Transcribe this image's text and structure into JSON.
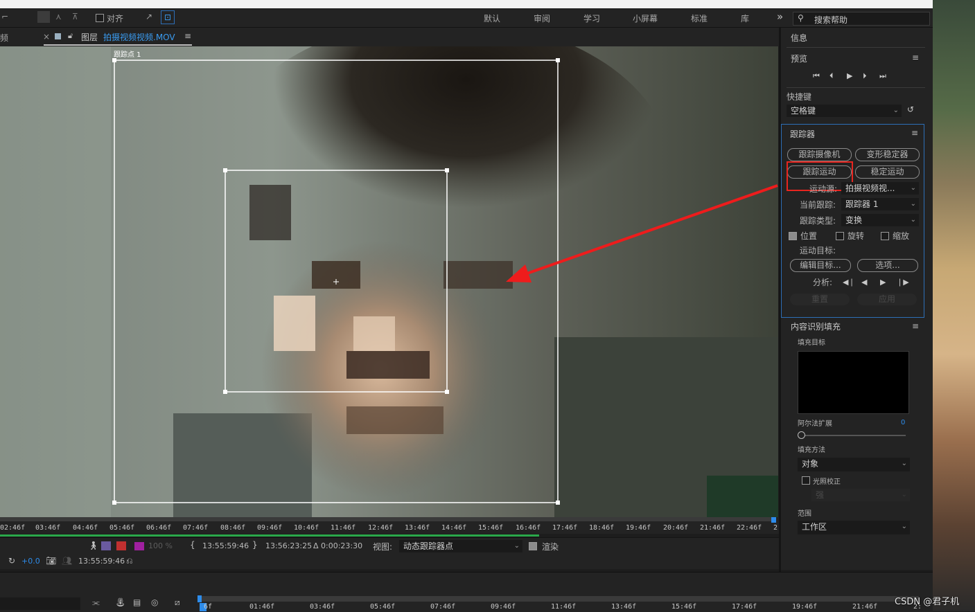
{
  "topbar": {
    "align_label": "对齐",
    "workspaces": [
      "默认",
      "审阅",
      "学习",
      "小屏幕",
      "标准",
      "库"
    ],
    "more": "»",
    "search_placeholder": "搜索帮助"
  },
  "layer_tab": {
    "prefix": "图层",
    "name": "拍摄视频视频.MOV",
    "left_fragment": "频",
    "close": "×",
    "menu": "≡"
  },
  "viewer": {
    "track_point_label": "跟踪点 1"
  },
  "ruler": {
    "ticks": [
      "02:46f",
      "03:46f",
      "04:46f",
      "05:46f",
      "06:46f",
      "07:46f",
      "08:46f",
      "09:46f",
      "10:46f",
      "11:46f",
      "12:46f",
      "13:46f",
      "14:46f",
      "15:46f",
      "16:46f",
      "17:46f",
      "18:46f",
      "19:46f",
      "20:46f",
      "21:46f",
      "22:46f",
      "2"
    ]
  },
  "controls": {
    "zoom": "100 %",
    "in_time": "13:55:59:46",
    "out_time": "13:56:23:25",
    "duration": "Δ 0:00:23:30",
    "view_label": "视图:",
    "view_value": "动态跟踪器点",
    "render_label": "渲染",
    "exposure": "+0.0",
    "current_time": "13:55:59:46"
  },
  "timeline": {
    "ticks": [
      "6f",
      "01:46f",
      "03:46f",
      "05:46f",
      "07:46f",
      "09:46f",
      "11:46f",
      "13:46f",
      "15:46f",
      "17:46f",
      "19:46f",
      "21:46f",
      "2:"
    ]
  },
  "right_panel": {
    "info_title": "信息",
    "preview_title": "预览",
    "shortcut_label": "快捷键",
    "shortcut_value": "空格键",
    "tracker_title": "跟踪器",
    "track_camera": "跟踪摄像机",
    "warp_stabilizer": "变形稳定器",
    "track_motion": "跟踪运动",
    "stabilize_motion": "稳定运动",
    "motion_source_label": "运动源:",
    "motion_source_value": "拍摄视频视...",
    "current_track_label": "当前跟踪:",
    "current_track_value": "跟踪器 1",
    "track_type_label": "跟踪类型:",
    "track_type_value": "变换",
    "position": "位置",
    "rotation": "旋转",
    "scale": "缩放",
    "motion_target_label": "运动目标:",
    "edit_target": "编辑目标...",
    "options": "选项...",
    "analyze_label": "分析:",
    "reset": "重置",
    "apply": "应用",
    "caf_title": "内容识别填充",
    "fill_target_label": "填充目标",
    "alpha_expand_label": "阿尔法扩展",
    "alpha_expand_value": "0",
    "fill_method_label": "填充方法",
    "fill_method_value": "对象",
    "lighting_label": "光照校正",
    "lighting_value": "强",
    "range_label": "范围",
    "range_value": "工作区"
  },
  "watermark": "CSDN @君子机",
  "colors": {
    "accent": "#2d8ceb",
    "highlight_box": "#e8251f",
    "arrow": "#ee1c1c",
    "layer_name": "#3a9bf0"
  }
}
